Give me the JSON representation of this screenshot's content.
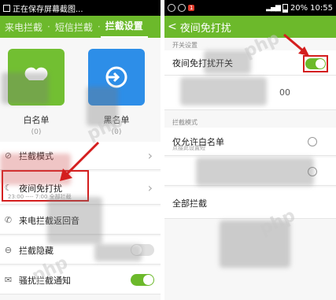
{
  "left": {
    "status": {
      "title": "正在保存屏幕截图..."
    },
    "appbar": {
      "tabs": [
        "来电拦截",
        "短信拦截",
        "拦截设置"
      ],
      "separator": "·"
    },
    "tiles": [
      {
        "label": "白名单",
        "count": "(0)"
      },
      {
        "label": "黑名单",
        "count": "(0)"
      }
    ],
    "list": [
      {
        "label": "拦截模式",
        "icon": "block-icon"
      },
      {
        "label": "夜间免打扰",
        "sub": "23:00 ---- 7:00 全部拦截",
        "icon": "moon-icon"
      },
      {
        "label": "来电拦截返回音",
        "icon": "phone-icon"
      },
      {
        "label": "拦截隐藏",
        "icon": "lock-icon"
      },
      {
        "label": "骚扰拦截通知",
        "icon": "mail-icon"
      }
    ]
  },
  "right": {
    "status": {
      "battery": "20%",
      "time": "10:55",
      "badge": "1"
    },
    "appbar": {
      "back": "<",
      "title": "夜间免打扰"
    },
    "section_switch": "开关设置",
    "switch_label": "夜间免打扰开关",
    "time_label": "00",
    "section_mode": "拦截模式",
    "options": [
      {
        "label": "仅允许白名单",
        "hint": "点接此设置短"
      },
      {
        "label": ""
      },
      {
        "label": "全部拦截"
      }
    ]
  },
  "watermark": "php"
}
